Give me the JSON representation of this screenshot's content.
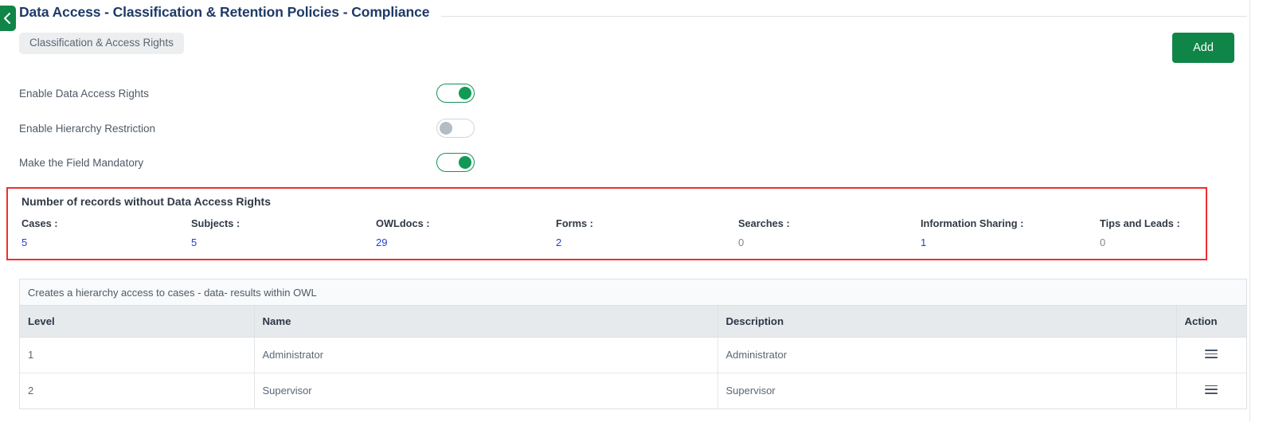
{
  "header": {
    "back_icon": "chevron-left-icon",
    "title": "Data Access - Classification & Retention Policies - Compliance"
  },
  "tabs": [
    {
      "label": "Classification & Access Rights",
      "active": true
    }
  ],
  "toolbar": {
    "add_label": "Add"
  },
  "settings": [
    {
      "label": "Enable Data Access Rights",
      "state": "on"
    },
    {
      "label": "Enable Hierarchy Restriction",
      "state": "off"
    },
    {
      "label": "Make the Field Mandatory",
      "state": "on"
    }
  ],
  "stats_panel": {
    "title": "Number of records without Data Access Rights",
    "highlight_color": "#f02e2e",
    "items": [
      {
        "label": "Cases :",
        "value": "5",
        "is_link": true
      },
      {
        "label": "Subjects :",
        "value": "5",
        "is_link": true
      },
      {
        "label": "OWLdocs :",
        "value": "29",
        "is_link": true
      },
      {
        "label": "Forms :",
        "value": "2",
        "is_link": true
      },
      {
        "label": "Searches :",
        "value": "0",
        "is_link": false
      },
      {
        "label": "Information Sharing :",
        "value": "1",
        "is_link": true
      },
      {
        "label": "Tips and Leads :",
        "value": "0",
        "is_link": false
      }
    ]
  },
  "table": {
    "caption": "Creates a hierarchy access to cases - data- results within OWL",
    "columns": [
      "Level",
      "Name",
      "Description",
      "Action"
    ],
    "rows": [
      {
        "level": "1",
        "name": "Administrator",
        "description": "Administrator",
        "action_icon": "hamburger-menu-icon"
      },
      {
        "level": "2",
        "name": "Supervisor",
        "description": "Supervisor",
        "action_icon": "hamburger-menu-icon"
      }
    ]
  },
  "colors": {
    "brand_green": "#108548",
    "title_navy": "#1f3a68",
    "link_blue": "#2540c8"
  }
}
